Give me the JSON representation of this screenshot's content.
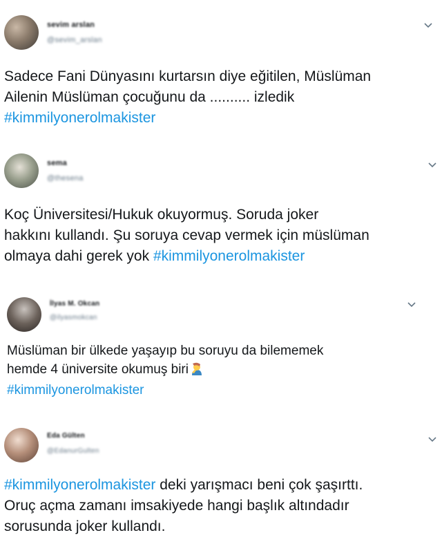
{
  "tweets": [
    {
      "name": "sevim arslan",
      "handle": "@sevim_arslan",
      "lines": [
        "Sadece Fani Dünyasını kurtarsın diye eğitilen, Müslüman",
        "Ailenin  Müslüman çocuğunu da .......... izledik"
      ],
      "hashtag": "#kimmilyonerolmakister",
      "trailing": ""
    },
    {
      "name": "sema",
      "handle": "@thesena",
      "lines": [
        "Koç Üniversitesi/Hukuk okuyormuş. Soruda joker",
        "hakkını kullandı. Şu soruya cevap vermek için müslüman"
      ],
      "last_prefix": "olmaya dahi gerek yok ",
      "hashtag": "#kimmilyonerolmakister"
    },
    {
      "name": "İlyas M. Okcan",
      "handle": "@ilyasmokcan",
      "lines": [
        "Müslüman bir ülkede yaşayıp bu soruyu da bilememek",
        "hemde 4 üniversite okumuş biri"
      ],
      "emoji_icon": "person-facepalming-emoji",
      "hashtag": "#kimmilyonerolmakister"
    },
    {
      "name": "Eda Gülten",
      "handle": "@EdanurGulten",
      "hashtag": "#kimmilyonerolmakister",
      "after_hashtag": " deki yarışmacı beni çok şaşırttı.",
      "lines": [
        "Oruç açma zamanı imsakiyede hangi başlık altındadır",
        "sorusunda joker kullandı."
      ]
    }
  ],
  "colors": {
    "hashtag": "#1b95e0",
    "text": "#14171a",
    "secondary": "#657786"
  },
  "icons": {
    "menu": "chevron-down-icon"
  }
}
